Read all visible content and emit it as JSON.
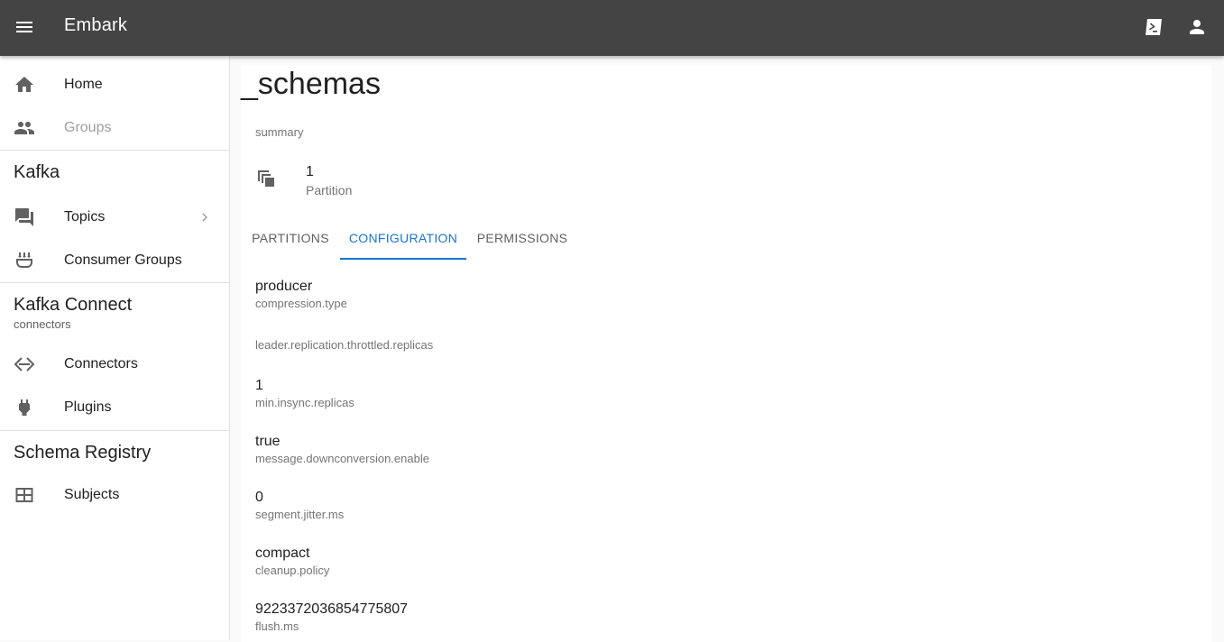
{
  "appbar": {
    "title": "Embark",
    "icons": {
      "menu": "menu-icon",
      "console": "console-icon",
      "account": "account-icon"
    }
  },
  "sidebar": {
    "items": [
      {
        "label": "Home",
        "icon": "home-icon"
      },
      {
        "label": "Groups",
        "icon": "groups-icon",
        "disabled": true
      }
    ],
    "kafka": {
      "title": "Kafka",
      "items": [
        {
          "label": "Topics",
          "icon": "forum-icon",
          "has_chevron": true
        },
        {
          "label": "Consumer Groups",
          "icon": "consumer-groups-icon"
        }
      ]
    },
    "kafka_connect": {
      "title": "Kafka Connect",
      "subtitle": "connectors",
      "items": [
        {
          "label": "Connectors",
          "icon": "connectors-icon"
        },
        {
          "label": "Plugins",
          "icon": "plug-icon"
        }
      ]
    },
    "schema_registry": {
      "title": "Schema Registry",
      "items": [
        {
          "label": "Subjects",
          "icon": "table-icon"
        }
      ]
    }
  },
  "main": {
    "title": "_schemas",
    "summary_label": "summary",
    "stat": {
      "value": "1",
      "label": "Partition",
      "icon": "copy-icon"
    },
    "tabs": [
      {
        "label": "PARTITIONS",
        "active": false
      },
      {
        "label": "CONFIGURATION",
        "active": true
      },
      {
        "label": "PERMISSIONS",
        "active": false
      }
    ],
    "config": [
      {
        "value": "producer",
        "key": "compression.type"
      },
      {
        "value": "",
        "key": "leader.replication.throttled.replicas"
      },
      {
        "value": "1",
        "key": "min.insync.replicas"
      },
      {
        "value": "true",
        "key": "message.downconversion.enable"
      },
      {
        "value": "0",
        "key": "segment.jitter.ms"
      },
      {
        "value": "compact",
        "key": "cleanup.policy"
      },
      {
        "value": "9223372036854775807",
        "key": "flush.ms"
      }
    ]
  },
  "colors": {
    "appbar": "#444444",
    "accent": "#1976d2",
    "icon": "#616161"
  }
}
